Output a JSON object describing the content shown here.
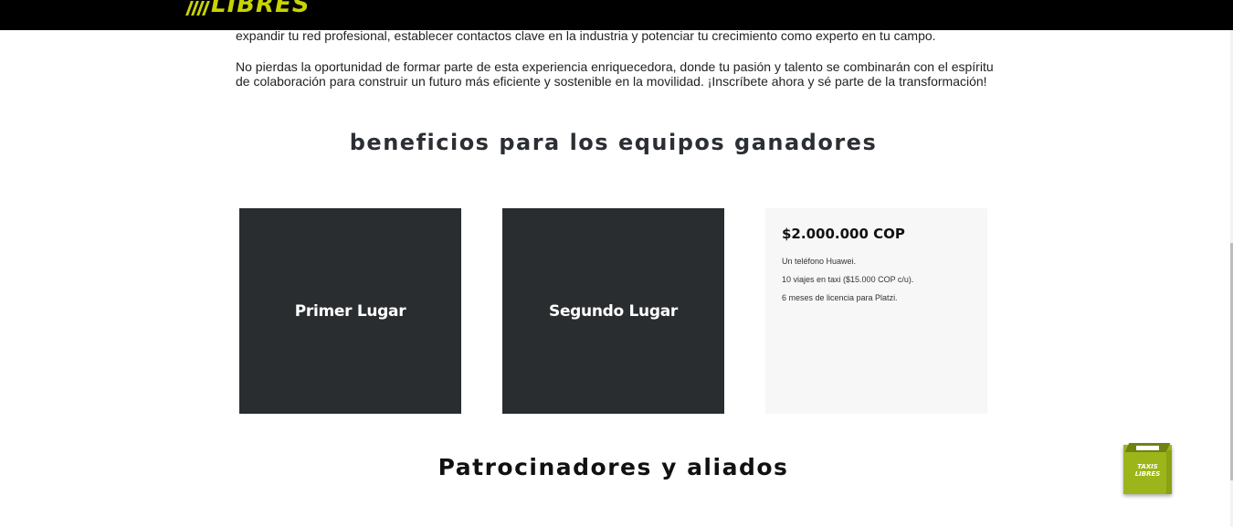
{
  "header": {
    "logo_text": "LIBRES",
    "colors": {
      "background": "#000000",
      "accent": "#c8d400"
    }
  },
  "intro": {
    "paragraph_1": "expandir tu red profesional, establecer contactos clave en la industria y potenciar tu crecimiento como experto en tu campo.",
    "paragraph_2": "No pierdas la oportunidad de formar parte de esta experiencia enriquecedora, donde tu pasión y talento se combinarán con el espíritu de colaboración para construir un futuro más eficiente y sostenible en la movilidad. ¡Inscríbete ahora y sé parte de la transformación!"
  },
  "benefits": {
    "title": "beneficios para los equipos ganadores",
    "cards": [
      {
        "label": "Primer Lugar"
      },
      {
        "label": "Segundo Lugar"
      },
      {
        "amount": "$2.000.000 COP",
        "items": [
          "Un teléfono Huawei.",
          "10 viajes en taxi ($15.000 COP c/u).",
          "6 meses de licencia para Platzi."
        ]
      }
    ],
    "colors": {
      "dark_card": "#2a2d2f",
      "light_card": "#f7f7f7"
    }
  },
  "sponsors": {
    "title": "Patrocinadores y aliados"
  },
  "widget": {
    "icon": "taxi-box-icon",
    "label": "TAXIS LIBRES",
    "color": "#9cb51a"
  }
}
